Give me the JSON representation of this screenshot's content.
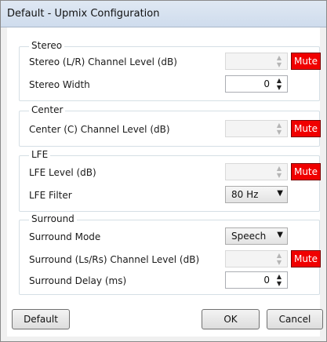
{
  "window": {
    "title": "Default - Upmix Configuration"
  },
  "groups": {
    "stereo": {
      "legend": "Stereo",
      "level_label": "Stereo (L/R) Channel Level (dB)",
      "level_value": "",
      "mute_label": "Mute",
      "width_label": "Stereo Width",
      "width_value": "0"
    },
    "center": {
      "legend": "Center",
      "level_label": "Center (C) Channel Level (dB)",
      "level_value": "",
      "mute_label": "Mute"
    },
    "lfe": {
      "legend": "LFE",
      "level_label": "LFE Level (dB)",
      "level_value": "",
      "mute_label": "Mute",
      "filter_label": "LFE Filter",
      "filter_value": "80 Hz"
    },
    "surround": {
      "legend": "Surround",
      "mode_label": "Surround Mode",
      "mode_value": "Speech",
      "level_label": "Surround (Ls/Rs) Channel Level (dB)",
      "level_value": "",
      "mute_label": "Mute",
      "delay_label": "Surround Delay (ms)",
      "delay_value": "0"
    }
  },
  "buttons": {
    "default_label": "Default",
    "ok_label": "OK",
    "cancel_label": "Cancel"
  },
  "icons": {
    "spin_up": "up-arrow-icon",
    "spin_down": "down-arrow-icon",
    "dropdown": "dropdown-caret-icon"
  },
  "colors": {
    "mute_active": "#f00000",
    "titlebar": "#cfdced",
    "client_bg": "#ffffff"
  }
}
